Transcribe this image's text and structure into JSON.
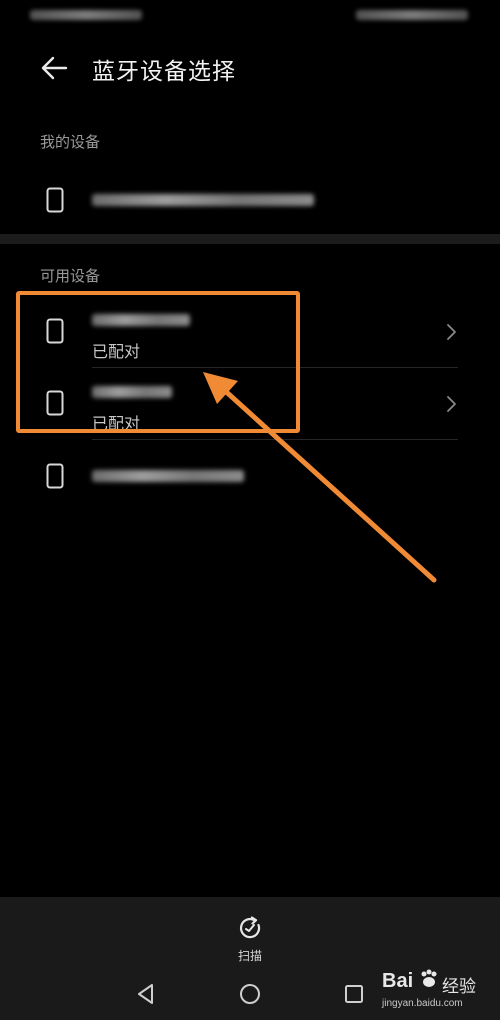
{
  "header": {
    "title": "蓝牙设备选择"
  },
  "sections": {
    "my_devices_label": "我的设备",
    "available_devices_label": "可用设备"
  },
  "devices": {
    "available": [
      {
        "status": "已配对"
      },
      {
        "status": "已配对"
      }
    ]
  },
  "bottom_bar": {
    "scan_label": "扫描"
  },
  "watermark": {
    "brand_a": "Bai",
    "brand_b": "经验",
    "url": "jingyan.baidu.com"
  },
  "colors": {
    "highlight": "#f08a35",
    "background": "#000000",
    "bottom_bar": "#1a1a1a"
  },
  "icons": {
    "back": "arrow-left-icon",
    "device": "phone-icon",
    "chevron": "chevron-right-icon",
    "scan": "refresh-icon",
    "nav_back": "triangle-left-icon",
    "nav_home": "circle-icon",
    "nav_recent": "square-icon"
  }
}
